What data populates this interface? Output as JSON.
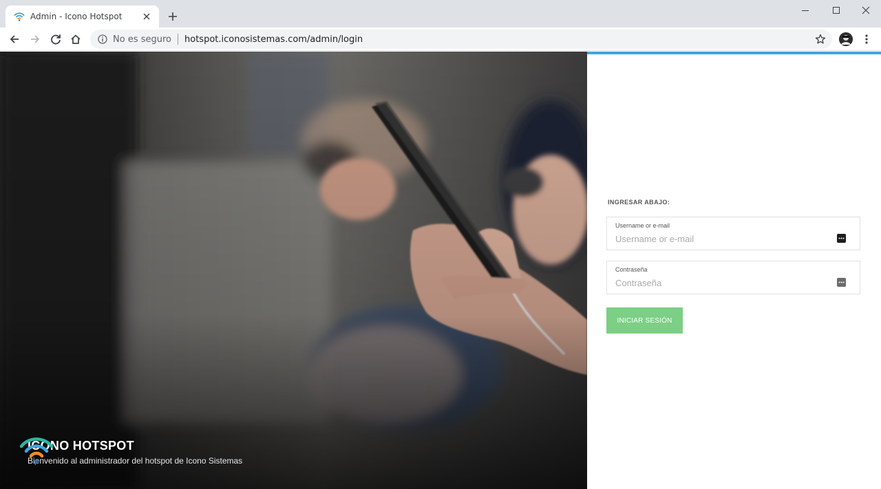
{
  "browser": {
    "tab_title": "Admin - Icono Hotspot",
    "security_label": "No es seguro",
    "url": "hotspot.iconosistemas.com/admin/login"
  },
  "brand": {
    "title": "ICONO HOTSPOT",
    "subtitle": "Bienvenido al administrador del hotspot de Icono Sistemas",
    "logo_colors": [
      "#2bb5a4",
      "#3ea6e3",
      "#f28c28"
    ]
  },
  "login": {
    "heading": "INGRESAR ABAJO:",
    "username_label": "Username or e-mail",
    "username_placeholder": "Username or e-mail",
    "password_label": "Contraseña",
    "password_placeholder": "Contraseña",
    "submit_label": "INICIAR SESIÓN"
  },
  "colors": {
    "accent_bar": "#3ea6e3",
    "button": "#7ccf85"
  }
}
